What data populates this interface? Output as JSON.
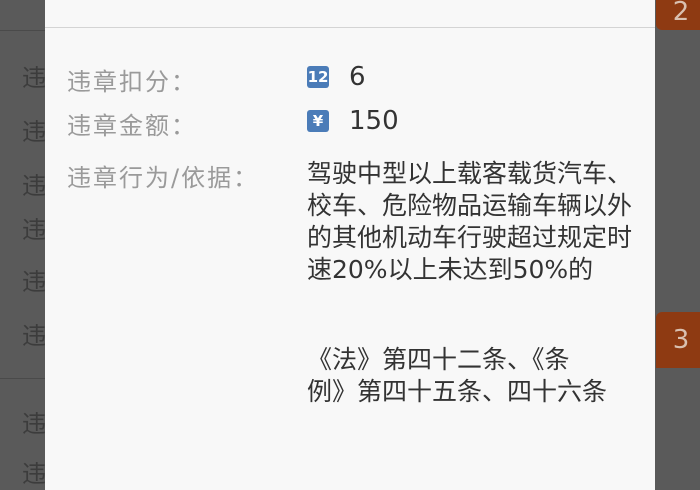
{
  "background": {
    "row_glyph": "违",
    "badge_top": "2",
    "badge_mid": "3"
  },
  "dialog": {
    "points_label": "违章扣分：",
    "points_icon_text": "12",
    "points_value": "6",
    "fine_label": "违章金额：",
    "fine_icon_text": "¥",
    "fine_value": "150",
    "behavior_label": "违章行为/依据：",
    "behavior_text": "驾驶中型以上载客载货汽车、校车、危险物品运输车辆以外的其他机动车行驶超过规定时速20%以上未达到50%的",
    "basis_text": "《法》第四十二条、《条例》第四十五条、四十六条"
  },
  "colors": {
    "icon_blue": "#4b7cb8",
    "badge_orange": "#8e3a12"
  }
}
